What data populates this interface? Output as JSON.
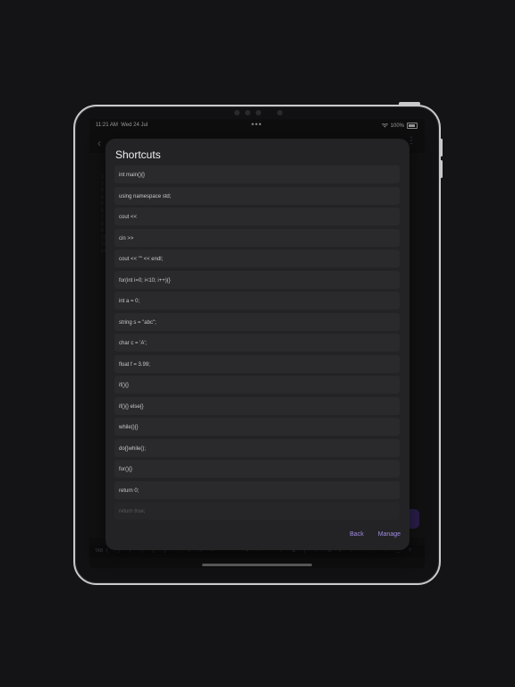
{
  "status_bar": {
    "time": "11:21 AM",
    "date": "Wed 24 Jul",
    "battery": "100%"
  },
  "editor": {
    "gutter_lines": [
      "1",
      "2",
      "3",
      "4",
      "5",
      "6",
      "7",
      "8",
      "9",
      "10",
      "11",
      "12"
    ],
    "key_bar": [
      "TAB",
      "{",
      "}",
      "(",
      ")",
      "[",
      "]",
      ";",
      "<",
      ">",
      "=",
      "\"",
      "'",
      "+",
      "-",
      "*",
      "/",
      "&",
      "|",
      "!",
      "%",
      "#",
      "\\",
      ":",
      ",",
      ".",
      "_",
      "?"
    ]
  },
  "dialog": {
    "title": "Shortcuts",
    "items": [
      "int main(){}",
      "using namespace std;",
      "cout <<",
      "cin >>",
      "cout << \"\" << endl;",
      "for(int i=0; i<10; i++){}",
      "int a = 0;",
      "string s = \"abc\";",
      "char c = 'A';",
      "float f = 3.99;",
      "if(){}",
      "if(){} else{}",
      "while(){}",
      "do{}while();",
      "for(){}",
      "return 0;",
      "return true;"
    ],
    "back_label": "Back",
    "manage_label": "Manage"
  },
  "colors": {
    "accent": "#a08be0",
    "fab": "#5b3ea8",
    "dialog_bg": "#232325"
  }
}
